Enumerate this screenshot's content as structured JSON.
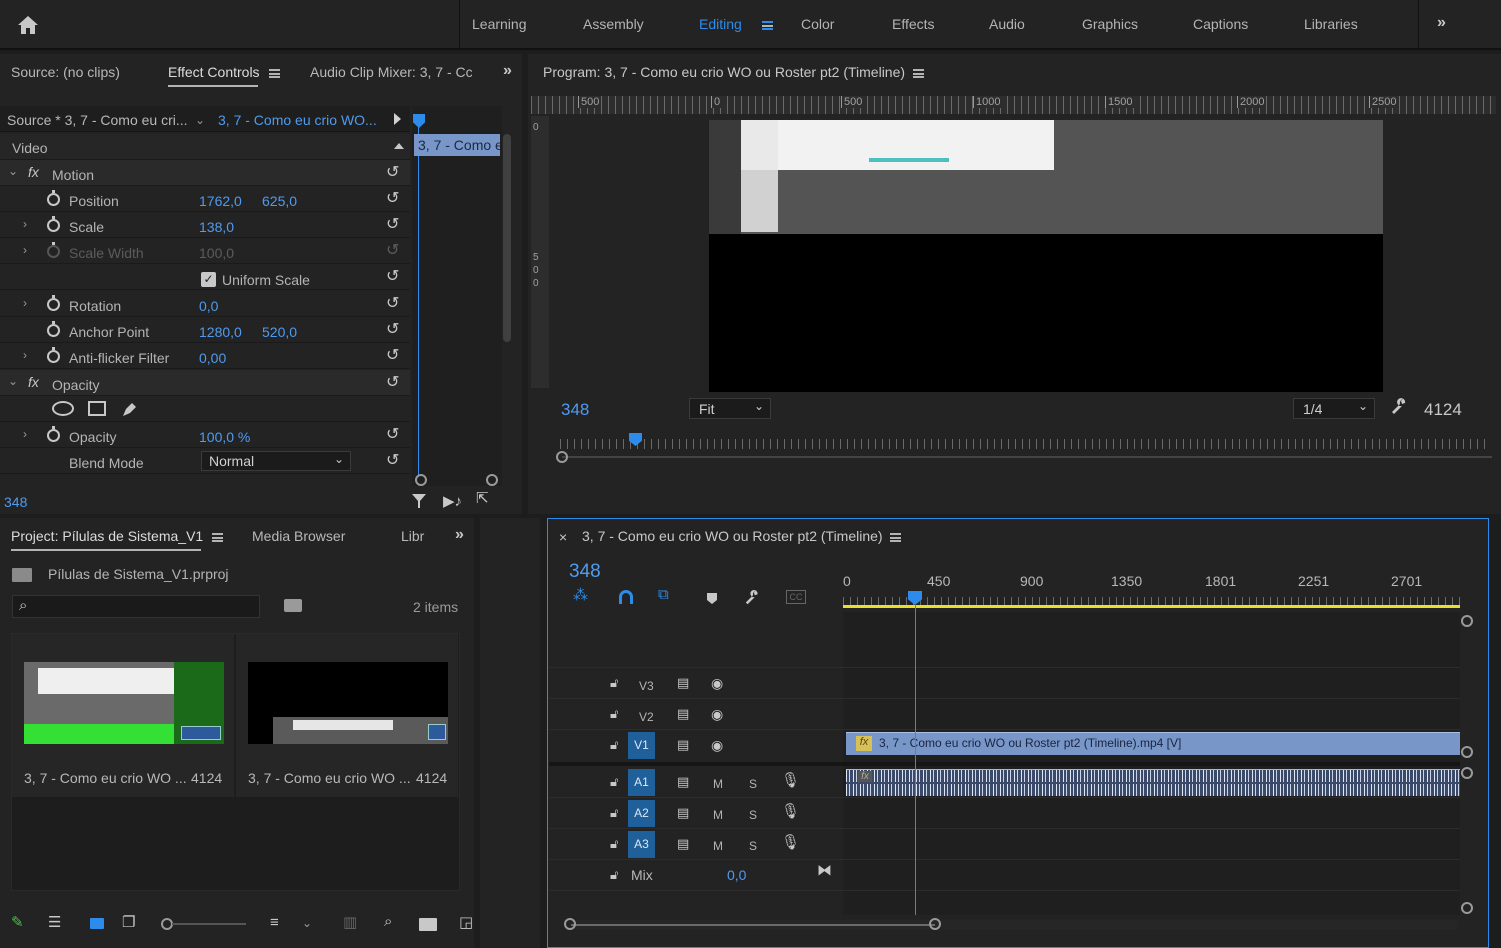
{
  "workspaces": [
    "Learning",
    "Assembly",
    "Editing",
    "Color",
    "Effects",
    "Audio",
    "Graphics",
    "Captions",
    "Libraries"
  ],
  "active_workspace": "Editing",
  "source_panel": {
    "tabs": {
      "source": "Source: (no clips)",
      "effect_controls": "Effect Controls",
      "audio_mixer": "Audio Clip Mixer: 3, 7 - Cc"
    },
    "source_selector": "Source * 3, 7 - Como eu cri...",
    "sequence_selector": "3, 7 - Como eu crio WO...",
    "mini_clip": "3, 7 - Como e",
    "section_video": "Video",
    "motion": {
      "label": "Motion",
      "position": {
        "label": "Position",
        "x": "1762,0",
        "y": "625,0"
      },
      "scale": {
        "label": "Scale",
        "value": "138,0"
      },
      "scale_width": {
        "label": "Scale Width",
        "value": "100,0"
      },
      "uniform_scale": {
        "label": "Uniform Scale",
        "checked": true
      },
      "rotation": {
        "label": "Rotation",
        "value": "0,0"
      },
      "anchor": {
        "label": "Anchor Point",
        "x": "1280,0",
        "y": "520,0"
      },
      "antiflicker": {
        "label": "Anti-flicker Filter",
        "value": "0,00"
      }
    },
    "opacity": {
      "label": "Opacity",
      "value_label": "Opacity",
      "value": "100,0 %",
      "blend_label": "Blend Mode",
      "blend_value": "Normal"
    },
    "timecode": "348"
  },
  "program_panel": {
    "title": "Program: 3, 7 - Como eu crio WO ou Roster pt2 (Timeline)",
    "ruler": [
      "500",
      "0",
      "500",
      "1000",
      "1500",
      "2000",
      "2500"
    ],
    "vruler": [
      "0",
      "5",
      "0",
      "0"
    ],
    "timecode": "348",
    "fit": "Fit",
    "resolution": "1/4",
    "duration": "4124",
    "playhead_fraction": 0.092
  },
  "project_panel": {
    "tabs": {
      "project": "Project: Pílulas de Sistema_V1",
      "media": "Media Browser",
      "libraries": "Libr"
    },
    "file": "Pílulas de Sistema_V1.prproj",
    "items_count": "2 items",
    "search_placeholder": "",
    "items": [
      {
        "name": "3, 7 - Como eu crio WO ...",
        "duration": "4124"
      },
      {
        "name": "3, 7 - Como eu crio WO ...",
        "duration": "4124"
      }
    ]
  },
  "timeline": {
    "title": "3, 7 - Como eu crio WO ou Roster pt2 (Timeline)",
    "timecode": "348",
    "ruler": [
      "0",
      "450",
      "900",
      "1350",
      "1801",
      "2251",
      "2701"
    ],
    "tracks": {
      "video": [
        {
          "name": "V3"
        },
        {
          "name": "V2"
        },
        {
          "name": "V1",
          "targeted": true
        }
      ],
      "audio": [
        {
          "name": "A1",
          "m": "M",
          "s": "S"
        },
        {
          "name": "A2",
          "m": "M",
          "s": "S"
        },
        {
          "name": "A3",
          "m": "M",
          "s": "S"
        }
      ]
    },
    "mix_label": "Mix",
    "mix_value": "0,0",
    "clip_video_label": "3, 7 - Como eu crio WO ou Roster pt2 (Timeline).mp4 [V]",
    "fx_label": "fx"
  },
  "colors": {
    "accent": "#2d8ceb",
    "clip_video": "#7896c8",
    "clip_audio": "#3c4a6a",
    "work_area": "#e8e02a"
  }
}
